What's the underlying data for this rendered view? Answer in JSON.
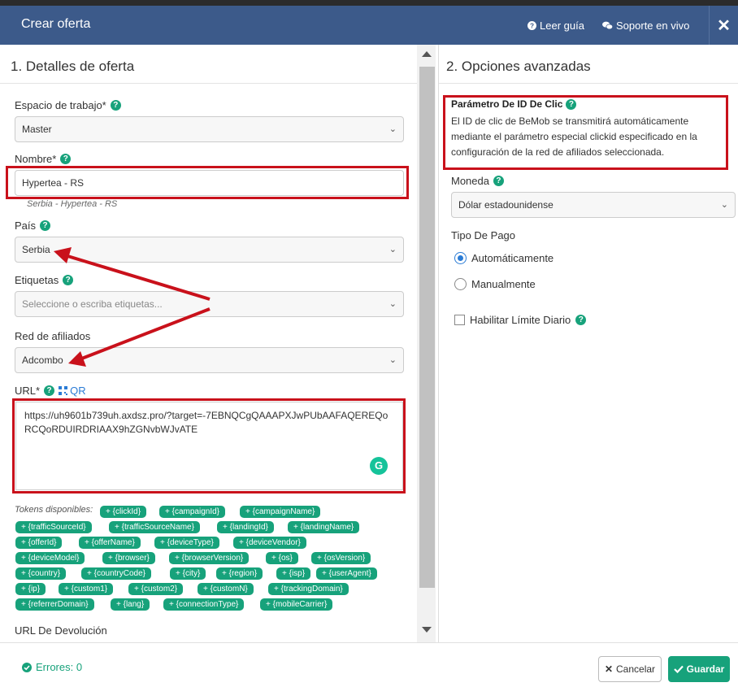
{
  "header": {
    "title": "Crear oferta",
    "guide_label": "Leer guía",
    "support_label": "Soporte en vivo",
    "close_symbol": "✕"
  },
  "left": {
    "panel_title": "1. Detalles de oferta",
    "workspace": {
      "label": "Espacio de trabajo*",
      "value": "Master"
    },
    "name": {
      "label": "Nombre*",
      "value": "Hypertea - RS",
      "preview": "Serbia - Hypertea - RS"
    },
    "country": {
      "label": "País",
      "value": "Serbia"
    },
    "tags": {
      "label": "Etiquetas",
      "placeholder": "Seleccione o escriba etiquetas..."
    },
    "network": {
      "label": "Red de afiliados",
      "value": "Adcombo"
    },
    "url": {
      "label": "URL*",
      "qr_label": "QR",
      "value": "https://uh9601b739uh.axdsz.pro/?target=-7EBNQCgQAAAPXJwPUbAAFAQEREQoRCQoRDUIRDRIAAX9hZGNvbWJvATE"
    },
    "tokens_label": "Tokens disponibles:",
    "tokens": [
      "+ {clickId}",
      "+ {campaignId}",
      "+ {campaignName}",
      "+ {trafficSourceId}",
      "+ {trafficSourceName}",
      "+ {landingId}",
      "+ {landingName}",
      "+ {offerId}",
      "+ {offerName}",
      "+ {deviceType}",
      "+ {deviceVendor}",
      "+ {deviceModel}",
      "+ {browser}",
      "+ {browserVersion}",
      "+ {os}",
      "+ {osVersion}",
      "+ {country}",
      "+ {countryCode}",
      "+ {city}",
      "+ {region}",
      "+ {isp}",
      "+ {userAgent}",
      "+ {ip}",
      "+ {custom1}",
      "+ {custom2}",
      "+ {customN}",
      "+ {trackingDomain}",
      "+ {referrerDomain}",
      "+ {lang}",
      "+ {connectionType}",
      "+ {mobileCarrier}"
    ],
    "postback_label": "URL De Devolución"
  },
  "right": {
    "panel_title": "2. Opciones avanzadas",
    "click_param_title": "Parámetro De ID De Clic",
    "click_param_desc": "El ID de clic de BeMob se transmitirá automáticamente mediante el parámetro especial clickid especificado en la configuración de la red de afiliados seleccionada.",
    "currency": {
      "label": "Moneda",
      "value": "Dólar estadounidense"
    },
    "payment_type_label": "Tipo De Pago",
    "payment_auto": "Automáticamente",
    "payment_manual": "Manualmente",
    "daily_limit_label": "Habilitar Límite Diario"
  },
  "footer": {
    "errors": "Errores: 0",
    "cancel_label": "Cancelar",
    "save_label": "Guardar"
  },
  "colors": {
    "header_bg": "#3c5a8a",
    "accent_green": "#17a27b",
    "annotation_red": "#c9111b"
  }
}
